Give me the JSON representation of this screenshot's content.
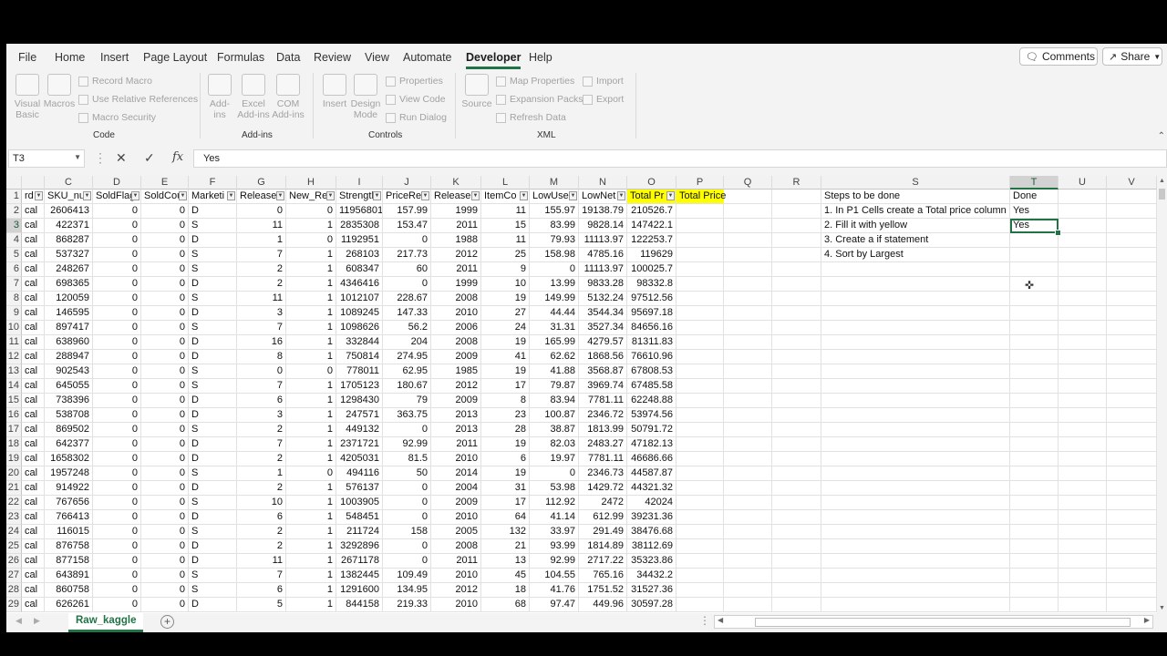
{
  "tabs": [
    "File",
    "Home",
    "Insert",
    "Page Layout",
    "Formulas",
    "Data",
    "Review",
    "View",
    "Automate",
    "Developer",
    "Help"
  ],
  "active_tab": "Developer",
  "comments_label": "Comments",
  "share_label": "Share",
  "ribbon": {
    "code": {
      "label": "Code",
      "visual_basic": "Visual Basic",
      "macros": "Macros",
      "record_macro": "Record Macro",
      "relative_refs": "Use Relative References",
      "macro_security": "Macro Security"
    },
    "addins": {
      "label": "Add-ins",
      "addins": "Add-ins",
      "excel_addins": "Excel Add-ins",
      "com_addins": "COM Add-ins"
    },
    "controls": {
      "label": "Controls",
      "insert": "Insert",
      "design_mode": "Design Mode",
      "properties": "Properties",
      "view_code": "View Code",
      "run_dialog": "Run Dialog"
    },
    "xml": {
      "label": "XML",
      "source": "Source",
      "map_properties": "Map Properties",
      "expansion_packs": "Expansion Packs",
      "refresh_data": "Refresh Data",
      "import": "Import",
      "export": "Export"
    }
  },
  "formula_bar": {
    "name_box": "T3",
    "formula": "Yes"
  },
  "columns": [
    "",
    "C",
    "D",
    "E",
    "F",
    "G",
    "H",
    "I",
    "J",
    "K",
    "L",
    "M",
    "N",
    "O",
    "P",
    "Q",
    "R",
    "S",
    "T",
    "U",
    "V"
  ],
  "selected_column": "T",
  "selected_row": "3",
  "headers": [
    "rd",
    "SKU_nu",
    "SoldFlag",
    "SoldCou",
    "Marketi",
    "Release",
    "New_Re",
    "Strength",
    "PriceRe",
    "Release",
    "ItemCo",
    "LowUse",
    "LowNet",
    "Total Pr",
    "Total Price"
  ],
  "rows": [
    [
      "2",
      "cal",
      "2606413",
      "0",
      "0",
      "D",
      "0",
      "0",
      "11956801",
      "157.99",
      "1999",
      "11",
      "155.97",
      "19138.79",
      "210526.7"
    ],
    [
      "3",
      "cal",
      "422371",
      "0",
      "0",
      "S",
      "11",
      "1",
      "2835308",
      "153.47",
      "2011",
      "15",
      "83.99",
      "9828.14",
      "147422.1"
    ],
    [
      "4",
      "cal",
      "868287",
      "0",
      "0",
      "D",
      "1",
      "0",
      "1192951",
      "0",
      "1988",
      "11",
      "79.93",
      "11113.97",
      "122253.7"
    ],
    [
      "5",
      "cal",
      "537327",
      "0",
      "0",
      "S",
      "7",
      "1",
      "268103",
      "217.73",
      "2012",
      "25",
      "158.98",
      "4785.16",
      "119629"
    ],
    [
      "6",
      "cal",
      "248267",
      "0",
      "0",
      "S",
      "2",
      "1",
      "608347",
      "60",
      "2011",
      "9",
      "0",
      "11113.97",
      "100025.7"
    ],
    [
      "7",
      "cal",
      "698365",
      "0",
      "0",
      "D",
      "2",
      "1",
      "4346416",
      "0",
      "1999",
      "10",
      "13.99",
      "9833.28",
      "98332.8"
    ],
    [
      "8",
      "cal",
      "120059",
      "0",
      "0",
      "S",
      "11",
      "1",
      "1012107",
      "228.67",
      "2008",
      "19",
      "149.99",
      "5132.24",
      "97512.56"
    ],
    [
      "9",
      "cal",
      "146595",
      "0",
      "0",
      "D",
      "3",
      "1",
      "1089245",
      "147.33",
      "2010",
      "27",
      "44.44",
      "3544.34",
      "95697.18"
    ],
    [
      "10",
      "cal",
      "897417",
      "0",
      "0",
      "S",
      "7",
      "1",
      "1098626",
      "56.2",
      "2006",
      "24",
      "31.31",
      "3527.34",
      "84656.16"
    ],
    [
      "11",
      "cal",
      "638960",
      "0",
      "0",
      "D",
      "16",
      "1",
      "332844",
      "204",
      "2008",
      "19",
      "165.99",
      "4279.57",
      "81311.83"
    ],
    [
      "12",
      "cal",
      "288947",
      "0",
      "0",
      "D",
      "8",
      "1",
      "750814",
      "274.95",
      "2009",
      "41",
      "62.62",
      "1868.56",
      "76610.96"
    ],
    [
      "13",
      "cal",
      "902543",
      "0",
      "0",
      "S",
      "0",
      "0",
      "778011",
      "62.95",
      "1985",
      "19",
      "41.88",
      "3568.87",
      "67808.53"
    ],
    [
      "14",
      "cal",
      "645055",
      "0",
      "0",
      "S",
      "7",
      "1",
      "1705123",
      "180.67",
      "2012",
      "17",
      "79.87",
      "3969.74",
      "67485.58"
    ],
    [
      "15",
      "cal",
      "738396",
      "0",
      "0",
      "D",
      "6",
      "1",
      "1298430",
      "79",
      "2009",
      "8",
      "83.94",
      "7781.11",
      "62248.88"
    ],
    [
      "16",
      "cal",
      "538708",
      "0",
      "0",
      "D",
      "3",
      "1",
      "247571",
      "363.75",
      "2013",
      "23",
      "100.87",
      "2346.72",
      "53974.56"
    ],
    [
      "17",
      "cal",
      "869502",
      "0",
      "0",
      "S",
      "2",
      "1",
      "449132",
      "0",
      "2013",
      "28",
      "38.87",
      "1813.99",
      "50791.72"
    ],
    [
      "18",
      "cal",
      "642377",
      "0",
      "0",
      "D",
      "7",
      "1",
      "2371721",
      "92.99",
      "2011",
      "19",
      "82.03",
      "2483.27",
      "47182.13"
    ],
    [
      "19",
      "cal",
      "1658302",
      "0",
      "0",
      "D",
      "2",
      "1",
      "4205031",
      "81.5",
      "2010",
      "6",
      "19.97",
      "7781.11",
      "46686.66"
    ],
    [
      "20",
      "cal",
      "1957248",
      "0",
      "0",
      "S",
      "1",
      "0",
      "494116",
      "50",
      "2014",
      "19",
      "0",
      "2346.73",
      "44587.87"
    ],
    [
      "21",
      "cal",
      "914922",
      "0",
      "0",
      "D",
      "2",
      "1",
      "576137",
      "0",
      "2004",
      "31",
      "53.98",
      "1429.72",
      "44321.32"
    ],
    [
      "22",
      "cal",
      "767656",
      "0",
      "0",
      "S",
      "10",
      "1",
      "1003905",
      "0",
      "2009",
      "17",
      "112.92",
      "2472",
      "42024"
    ],
    [
      "23",
      "cal",
      "766413",
      "0",
      "0",
      "D",
      "6",
      "1",
      "548451",
      "0",
      "2010",
      "64",
      "41.14",
      "612.99",
      "39231.36"
    ],
    [
      "24",
      "cal",
      "116015",
      "0",
      "0",
      "S",
      "2",
      "1",
      "211724",
      "158",
      "2005",
      "132",
      "33.97",
      "291.49",
      "38476.68"
    ],
    [
      "25",
      "cal",
      "876758",
      "0",
      "0",
      "D",
      "2",
      "1",
      "3292896",
      "0",
      "2008",
      "21",
      "93.99",
      "1814.89",
      "38112.69"
    ],
    [
      "26",
      "cal",
      "877158",
      "0",
      "0",
      "D",
      "11",
      "1",
      "2671178",
      "0",
      "2011",
      "13",
      "92.99",
      "2717.22",
      "35323.86"
    ],
    [
      "27",
      "cal",
      "643891",
      "0",
      "0",
      "S",
      "7",
      "1",
      "1382445",
      "109.49",
      "2010",
      "45",
      "104.55",
      "765.16",
      "34432.2"
    ],
    [
      "28",
      "cal",
      "860758",
      "0",
      "0",
      "S",
      "6",
      "1",
      "1291600",
      "134.95",
      "2012",
      "18",
      "41.76",
      "1751.52",
      "31527.36"
    ],
    [
      "29",
      "cal",
      "626261",
      "0",
      "0",
      "D",
      "5",
      "1",
      "844158",
      "219.33",
      "2010",
      "68",
      "97.47",
      "449.96",
      "30597.28"
    ]
  ],
  "steps": {
    "header": "Steps to be done",
    "items": [
      "1. In P1 Cells create a Total price column",
      "2. Fill it with yellow",
      "3. Create a if statement",
      "4. Sort by Largest"
    ]
  },
  "done": {
    "header": "Done",
    "values": [
      "Yes",
      "Yes"
    ]
  },
  "sheet_tab": "Raw_kaggle",
  "colors": {
    "accent": "#217346",
    "highlight": "#ffff00"
  }
}
